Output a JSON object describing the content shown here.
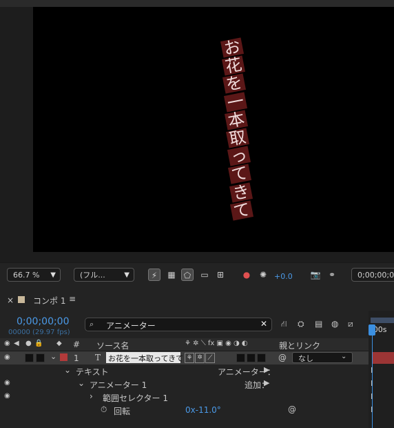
{
  "viewer": {
    "text_chars": [
      "お",
      "花",
      "を",
      "一",
      "本",
      "取",
      "っ",
      "て",
      "き",
      "て"
    ]
  },
  "toolbar": {
    "zoom": "66.7 %",
    "resolution": "(フル...",
    "exposure": "+0.0",
    "timecode": "0;00;00;00"
  },
  "timeline": {
    "tab_label": "コンポ 1",
    "menu_icon": "≡",
    "current_time": "0;00;00;00",
    "frame_info": "00000 (29.97 fps)",
    "search_value": "アニメーター",
    "time_marker": ":00s"
  },
  "columns": {
    "hash": "#",
    "source_name": "ソース名",
    "parent_link": "親とリンク"
  },
  "layer": {
    "number": "1",
    "type_icon": "T",
    "name": "お花を一本取ってきて",
    "parent_value": "なし",
    "label_color": "#b23a3a"
  },
  "props": {
    "text_group": "テキスト",
    "animator_menu": "アニメーター：",
    "animator_name": "アニメーター 1",
    "add_menu": "追加：",
    "range_selector": "範囲セレクター 1",
    "rotation_label": "回転",
    "rotation_value": "0x-11.0°"
  },
  "colors": {
    "accent_blue": "#3b8fe0",
    "text_box_red": "#5b1717",
    "timeline_bar_red": "#9b3535"
  }
}
